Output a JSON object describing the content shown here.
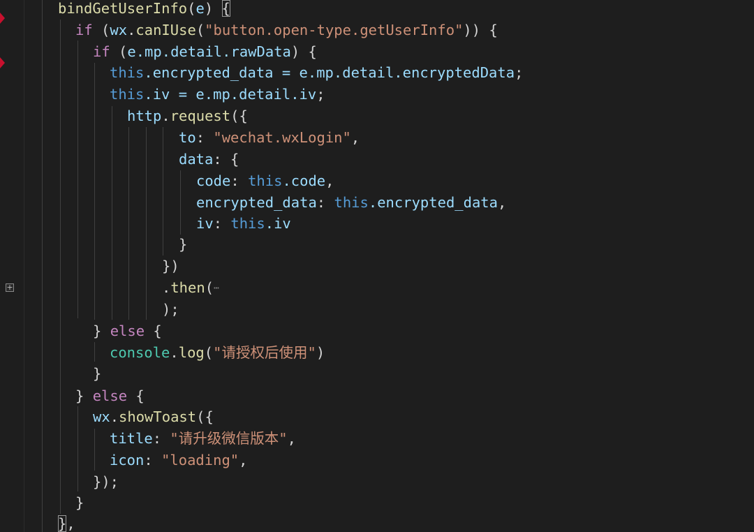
{
  "editor": {
    "language": "javascript",
    "theme_colors": {
      "background": "#1e1e1e",
      "keyword": "#c586c0",
      "this_keyword": "#569cd6",
      "variable": "#9cdcfe",
      "function": "#dcdcaa",
      "string": "#ce9178",
      "class": "#4ec9b0",
      "punctuation": "#d4d4d4",
      "breakpoint": "#c8102e"
    },
    "fold_icon": "plus-square-icon",
    "folded_placeholder": "⋯"
  },
  "code": {
    "l1": {
      "fn": "bindGetUserInfo",
      "open": "(",
      "param": "e",
      "close": ")",
      "brace": "{"
    },
    "l2": {
      "kw": "if",
      "p1": " (",
      "obj": "wx",
      "dot": ".",
      "fn": "canIUse",
      "p2": "(",
      "str": "\"button.open-type.getUserInfo\"",
      "p3": ")) {"
    },
    "l3": {
      "kw": "if",
      "p1": " (",
      "expr": "e.mp.detail.rawData",
      "p2": ") {"
    },
    "l4": {
      "th": "this",
      "expr": ".encrypted_data = e.mp.detail.encryptedData",
      "end": ";"
    },
    "l5": {
      "th": "this",
      "expr": ".iv = e.mp.detail.iv",
      "end": ";"
    },
    "l6": {
      "obj": "http",
      "dot": ".",
      "fn": "request",
      "p": "({"
    },
    "l7": {
      "key": "to",
      "colon": ": ",
      "str": "\"wechat.wxLogin\"",
      "end": ","
    },
    "l8": {
      "key": "data",
      "rest": ": {"
    },
    "l9": {
      "key": "code",
      "colon": ": ",
      "th": "this",
      "prop": ".code",
      "end": ","
    },
    "l10": {
      "key": "encrypted_data",
      "colon": ": ",
      "th": "this",
      "prop": ".encrypted_data",
      "end": ","
    },
    "l11": {
      "key": "iv",
      "colon": ": ",
      "th": "this",
      "prop": ".iv"
    },
    "l12": {
      "p": "}"
    },
    "l13": {
      "p": "})"
    },
    "l14": {
      "dot": ".",
      "fn": "then",
      "p": "("
    },
    "l15": {
      "p": ");"
    },
    "l16": {
      "p1": "} ",
      "kw": "else",
      "p2": " {"
    },
    "l17": {
      "cls": "console",
      "dot": ".",
      "fn": "log",
      "p1": "(",
      "str": "\"请授权后使用\"",
      "p2": ")"
    },
    "l18": {
      "p": "}"
    },
    "l19": {
      "p1": "} ",
      "kw": "else",
      "p2": " {"
    },
    "l20": {
      "obj": "wx",
      "dot": ".",
      "fn": "showToast",
      "p": "({"
    },
    "l21": {
      "key": "title",
      "colon": ": ",
      "str": "\"请升级微信版本\"",
      "end": ","
    },
    "l22": {
      "key": "icon",
      "colon": ": ",
      "str": "\"loading\"",
      "end": ","
    },
    "l23": {
      "p": "});"
    },
    "l24": {
      "p": "}"
    },
    "l25": {
      "brace": "}",
      "p": ","
    }
  }
}
